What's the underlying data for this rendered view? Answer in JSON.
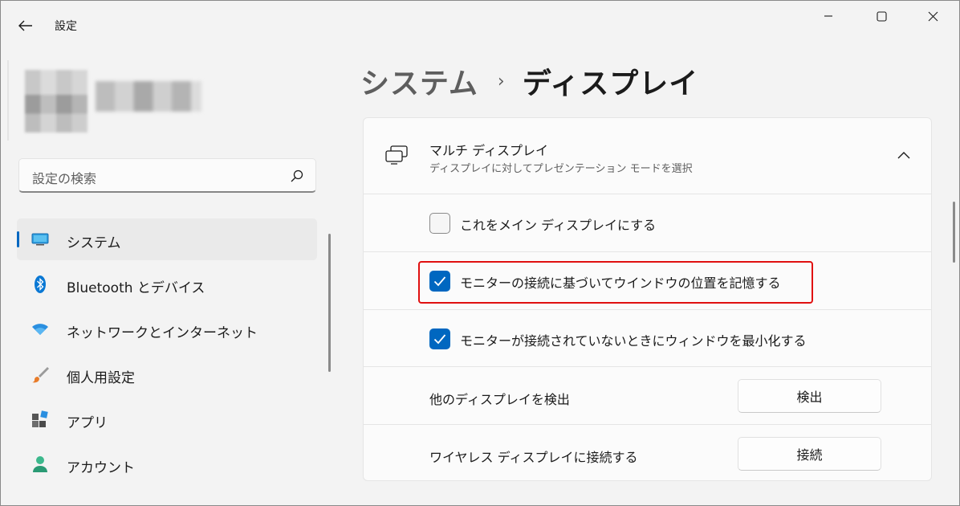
{
  "titlebar": {
    "title": "設定",
    "icons": [
      "back-arrow-icon",
      "minimize-icon",
      "maximize-icon",
      "close-icon"
    ]
  },
  "search": {
    "placeholder": "設定の検索",
    "icon": "search-icon"
  },
  "sidebar": {
    "items": [
      {
        "label": "システム",
        "icon": "system-display-icon",
        "active": true
      },
      {
        "label": "Bluetooth とデバイス",
        "icon": "bluetooth-icon"
      },
      {
        "label": "ネットワークとインターネット",
        "icon": "wifi-icon"
      },
      {
        "label": "個人用設定",
        "icon": "brush-icon"
      },
      {
        "label": "アプリ",
        "icon": "apps-icon"
      },
      {
        "label": "アカウント",
        "icon": "account-icon"
      }
    ]
  },
  "breadcrumb": {
    "parent": "システム",
    "separator": "›",
    "current": "ディスプレイ"
  },
  "multi_display": {
    "title": "マルチ ディスプレイ",
    "subtitle": "ディスプレイに対してプレゼンテーション モードを選択",
    "icon": "multi-display-icon",
    "expanded": true,
    "options": [
      {
        "label": "これをメイン ディスプレイにする",
        "checked": false
      },
      {
        "label": "モニターの接続に基づいてウインドウの位置を記憶する",
        "checked": true,
        "highlighted": true
      },
      {
        "label": "モニターが接続されていないときにウィンドウを最小化する",
        "checked": true
      }
    ],
    "detect": {
      "label": "他のディスプレイを検出",
      "button": "検出"
    },
    "wireless": {
      "label": "ワイヤレス ディスプレイに接続する",
      "button": "接続"
    }
  },
  "colors": {
    "accent": "#0067c0",
    "highlight": "#e01010"
  }
}
